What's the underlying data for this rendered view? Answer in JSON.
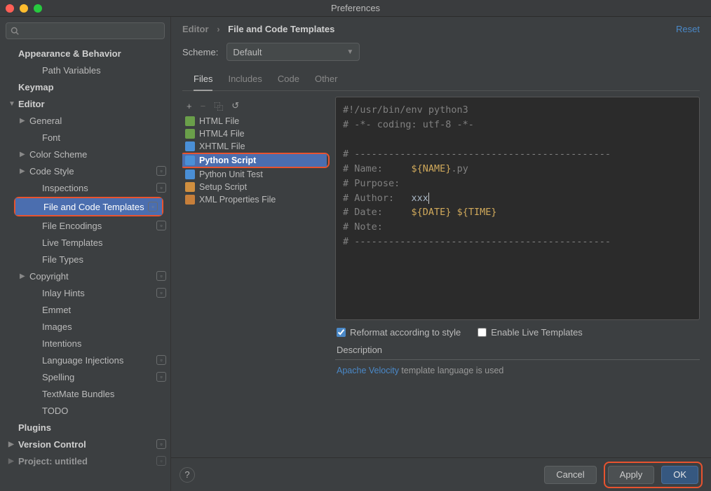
{
  "window": {
    "title": "Preferences"
  },
  "search": {
    "placeholder": ""
  },
  "sidebar": {
    "items": [
      {
        "label": "Appearance & Behavior",
        "level": 0,
        "header": true,
        "arrow": ""
      },
      {
        "label": "Path Variables",
        "level": 2
      },
      {
        "label": "Keymap",
        "level": 0,
        "header": true
      },
      {
        "label": "Editor",
        "level": 0,
        "header": true,
        "arrow": "▼"
      },
      {
        "label": "General",
        "level": 1,
        "arrow": "▶"
      },
      {
        "label": "Font",
        "level": 2
      },
      {
        "label": "Color Scheme",
        "level": 1,
        "arrow": "▶"
      },
      {
        "label": "Code Style",
        "level": 1,
        "arrow": "▶",
        "badge": true
      },
      {
        "label": "Inspections",
        "level": 2,
        "badge": true
      },
      {
        "label": "File and Code Templates",
        "level": 2,
        "badge": true,
        "selected": true,
        "highlight": true
      },
      {
        "label": "File Encodings",
        "level": 2,
        "badge": true
      },
      {
        "label": "Live Templates",
        "level": 2
      },
      {
        "label": "File Types",
        "level": 2
      },
      {
        "label": "Copyright",
        "level": 1,
        "arrow": "▶",
        "badge": true
      },
      {
        "label": "Inlay Hints",
        "level": 2,
        "badge": true
      },
      {
        "label": "Emmet",
        "level": 2
      },
      {
        "label": "Images",
        "level": 2
      },
      {
        "label": "Intentions",
        "level": 2
      },
      {
        "label": "Language Injections",
        "level": 2,
        "badge": true
      },
      {
        "label": "Spelling",
        "level": 2,
        "badge": true
      },
      {
        "label": "TextMate Bundles",
        "level": 2
      },
      {
        "label": "TODO",
        "level": 2
      },
      {
        "label": "Plugins",
        "level": 0,
        "header": true
      },
      {
        "label": "Version Control",
        "level": 0,
        "header": true,
        "arrow": "▶",
        "badge": true
      },
      {
        "label": "Project: untitled",
        "level": 0,
        "header": true,
        "arrow": "▶",
        "badge": true,
        "dim": true
      }
    ]
  },
  "breadcrumb": {
    "parent": "Editor",
    "current": "File and Code Templates",
    "reset": "Reset"
  },
  "scheme": {
    "label": "Scheme:",
    "value": "Default"
  },
  "tabs": [
    "Files",
    "Includes",
    "Code",
    "Other"
  ],
  "tabs_active": 0,
  "toolbar": {
    "add": "+",
    "remove": "−",
    "copy": "⿻",
    "revert": "↺"
  },
  "files": [
    {
      "label": "HTML File",
      "icon": "ic-html"
    },
    {
      "label": "HTML4 File",
      "icon": "ic-html"
    },
    {
      "label": "XHTML File",
      "icon": "ic-xhtml"
    },
    {
      "label": "Python Script",
      "icon": "ic-py",
      "selected": true,
      "highlight": true
    },
    {
      "label": "Python Unit Test",
      "icon": "ic-py"
    },
    {
      "label": "Setup Script",
      "icon": "ic-setup"
    },
    {
      "label": "XML Properties File",
      "icon": "ic-xml"
    }
  ],
  "editor_lines": [
    {
      "text": "#!/usr/bin/env python3"
    },
    {
      "text": "# -*- coding: utf-8 -*-"
    },
    {
      "text": ""
    },
    {
      "text": "# ---------------------------------------------"
    },
    {
      "prefix": "# Name:     ",
      "var": "${NAME}",
      "suffix": ".py"
    },
    {
      "text": "# Purpose:"
    },
    {
      "prefix": "# Author:   ",
      "value": "xxx",
      "cursor": true
    },
    {
      "prefix": "# Date:     ",
      "var": "${DATE} ${TIME}"
    },
    {
      "text": "# Note:"
    },
    {
      "text": "# ---------------------------------------------"
    }
  ],
  "checks": {
    "reformat": "Reformat according to style",
    "reformat_checked": true,
    "live": "Enable Live Templates",
    "live_checked": false
  },
  "description": {
    "label": "Description",
    "link": "Apache Velocity",
    "text": " template language is used"
  },
  "footer": {
    "cancel": "Cancel",
    "apply": "Apply",
    "ok": "OK"
  }
}
